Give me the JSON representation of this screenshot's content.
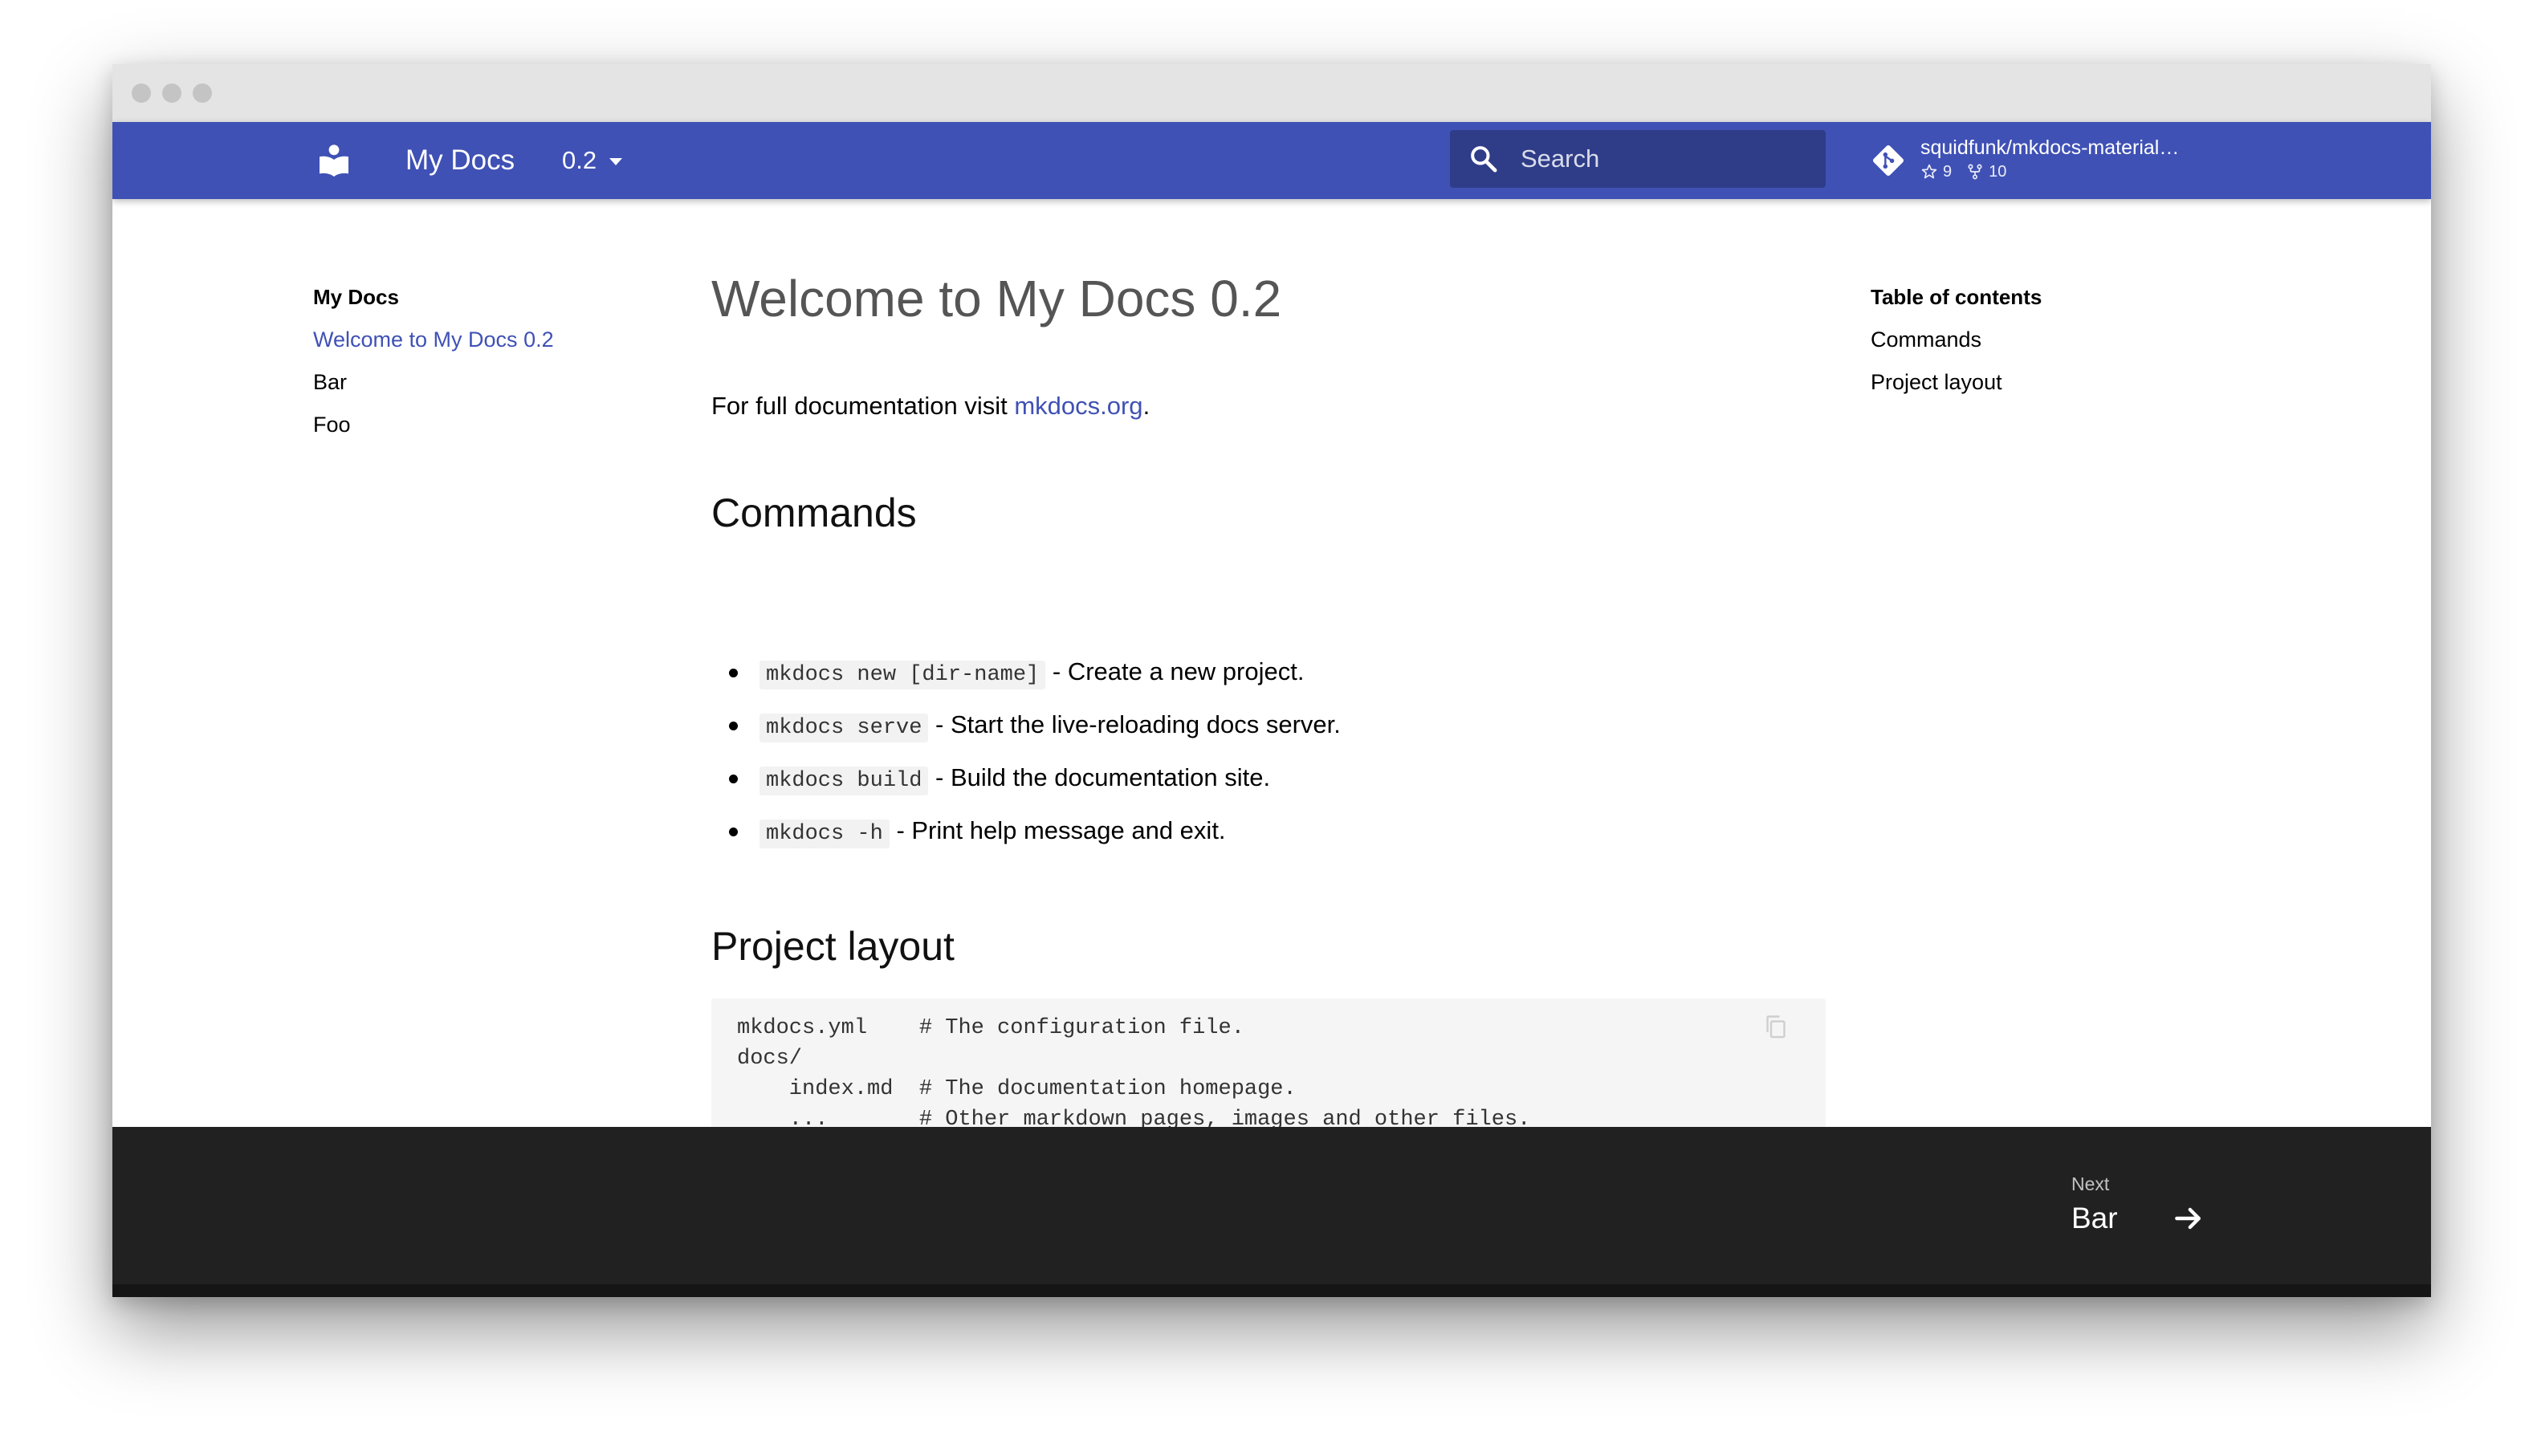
{
  "window": {
    "controls": [
      "close",
      "minimize",
      "maximize"
    ]
  },
  "header": {
    "logo_icon": "book-open-icon",
    "site_name": "My Docs",
    "version": "0.2",
    "search": {
      "placeholder": "Search",
      "value": ""
    },
    "repo": {
      "name": "squidfunk/mkdocs-material…",
      "stars": "9",
      "forks": "10"
    },
    "color": "#3f51b5"
  },
  "nav": {
    "title": "My Docs",
    "items": [
      {
        "label": "Welcome to My Docs 0.2",
        "active": true
      },
      {
        "label": "Bar",
        "active": false
      },
      {
        "label": "Foo",
        "active": false
      }
    ]
  },
  "toc": {
    "title": "Table of contents",
    "items": [
      "Commands",
      "Project layout"
    ]
  },
  "content": {
    "title": "Welcome to My Docs 0.2",
    "intro_text": "For full documentation visit ",
    "intro_link": "mkdocs.org",
    "intro_end": ".",
    "commands_heading": "Commands",
    "commands": [
      {
        "code": "mkdocs new [dir-name]",
        "text": " - Create a new project."
      },
      {
        "code": "mkdocs serve",
        "text": " - Start the live-reloading docs server."
      },
      {
        "code": "mkdocs build",
        "text": " - Build the documentation site."
      },
      {
        "code": "mkdocs -h",
        "text": " - Print help message and exit."
      }
    ],
    "layout_heading": "Project layout",
    "code_block": [
      "mkdocs.yml    # The configuration file.",
      "docs/",
      "    index.md  # The documentation homepage.",
      "    ...       # Other markdown pages, images and other files."
    ]
  },
  "footer": {
    "next_label": "Next",
    "next_title": "Bar",
    "background": "#212121"
  }
}
